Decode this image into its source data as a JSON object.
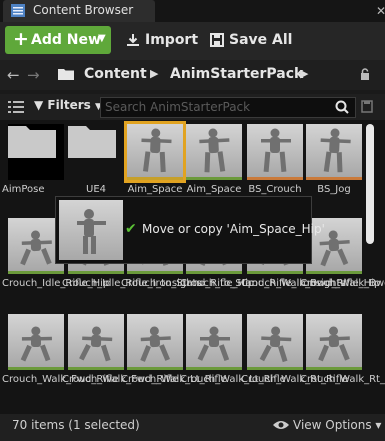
{
  "window": {
    "tab_label": "Content Browser",
    "close_glyph": "✕"
  },
  "toolbar": {
    "add_new_label": "Add New",
    "import_label": "Import",
    "save_all_label": "Save All"
  },
  "path": {
    "items": [
      "Content",
      "AnimStarterPack"
    ]
  },
  "filter": {
    "filters_label": "Filters",
    "search_placeholder": "Search AnimStarterPack"
  },
  "assets": [
    {
      "label": "AimPose",
      "kind": "folder"
    },
    {
      "label": "UE4",
      "kind": "folder"
    },
    {
      "label": "Aim_Space",
      "kind": "anim",
      "selected": true
    },
    {
      "label": "Aim_Space",
      "kind": "anim"
    },
    {
      "label": "BS_Crouch",
      "kind": "anim"
    },
    {
      "label": "BS_Jog",
      "kind": "anim"
    },
    {
      "label": "Crouch_Idle_Rifle_Hip",
      "kind": "anim"
    },
    {
      "label": "Crouch_Idle_Rifle_Ironsights",
      "kind": "anim"
    },
    {
      "label": "Crouch_to_Stand_Rifle_Hip",
      "kind": "anim"
    },
    {
      "label": "Crouch_to_Stand_Rifle_Ironsights",
      "kind": "anim"
    },
    {
      "label": "Crouch_Walk_Bwd_Rifle_Hip",
      "kind": "anim"
    },
    {
      "label": "Crouch_Walk_Bwd_Rifle",
      "kind": "anim"
    },
    {
      "label": "Crouch_Walk_Fwd_Rifle",
      "kind": "anim"
    },
    {
      "label": "Crouch_Walk_Fwd_Rifle",
      "kind": "anim"
    },
    {
      "label": "Crouch_Walk_Lt_Rifle",
      "kind": "anim"
    },
    {
      "label": "Crouch_Walk_Lt_Rifle",
      "kind": "anim"
    },
    {
      "label": "Crouch_Walk_Rt_Rifle",
      "kind": "anim"
    },
    {
      "label": "Crouch_Walk_Rt_Rifle",
      "kind": "anim"
    }
  ],
  "tooltip": {
    "message": "Move or copy 'Aim_Space_Hip'"
  },
  "status": {
    "item_count": "70 items (1 selected)",
    "view_options_label": "View Options",
    "view_options_caret": "▾"
  },
  "colors": {
    "add_new_green": "#5fa83a",
    "selection_orange": "#e1a321",
    "anim_border_green": "#6b9a3b"
  }
}
